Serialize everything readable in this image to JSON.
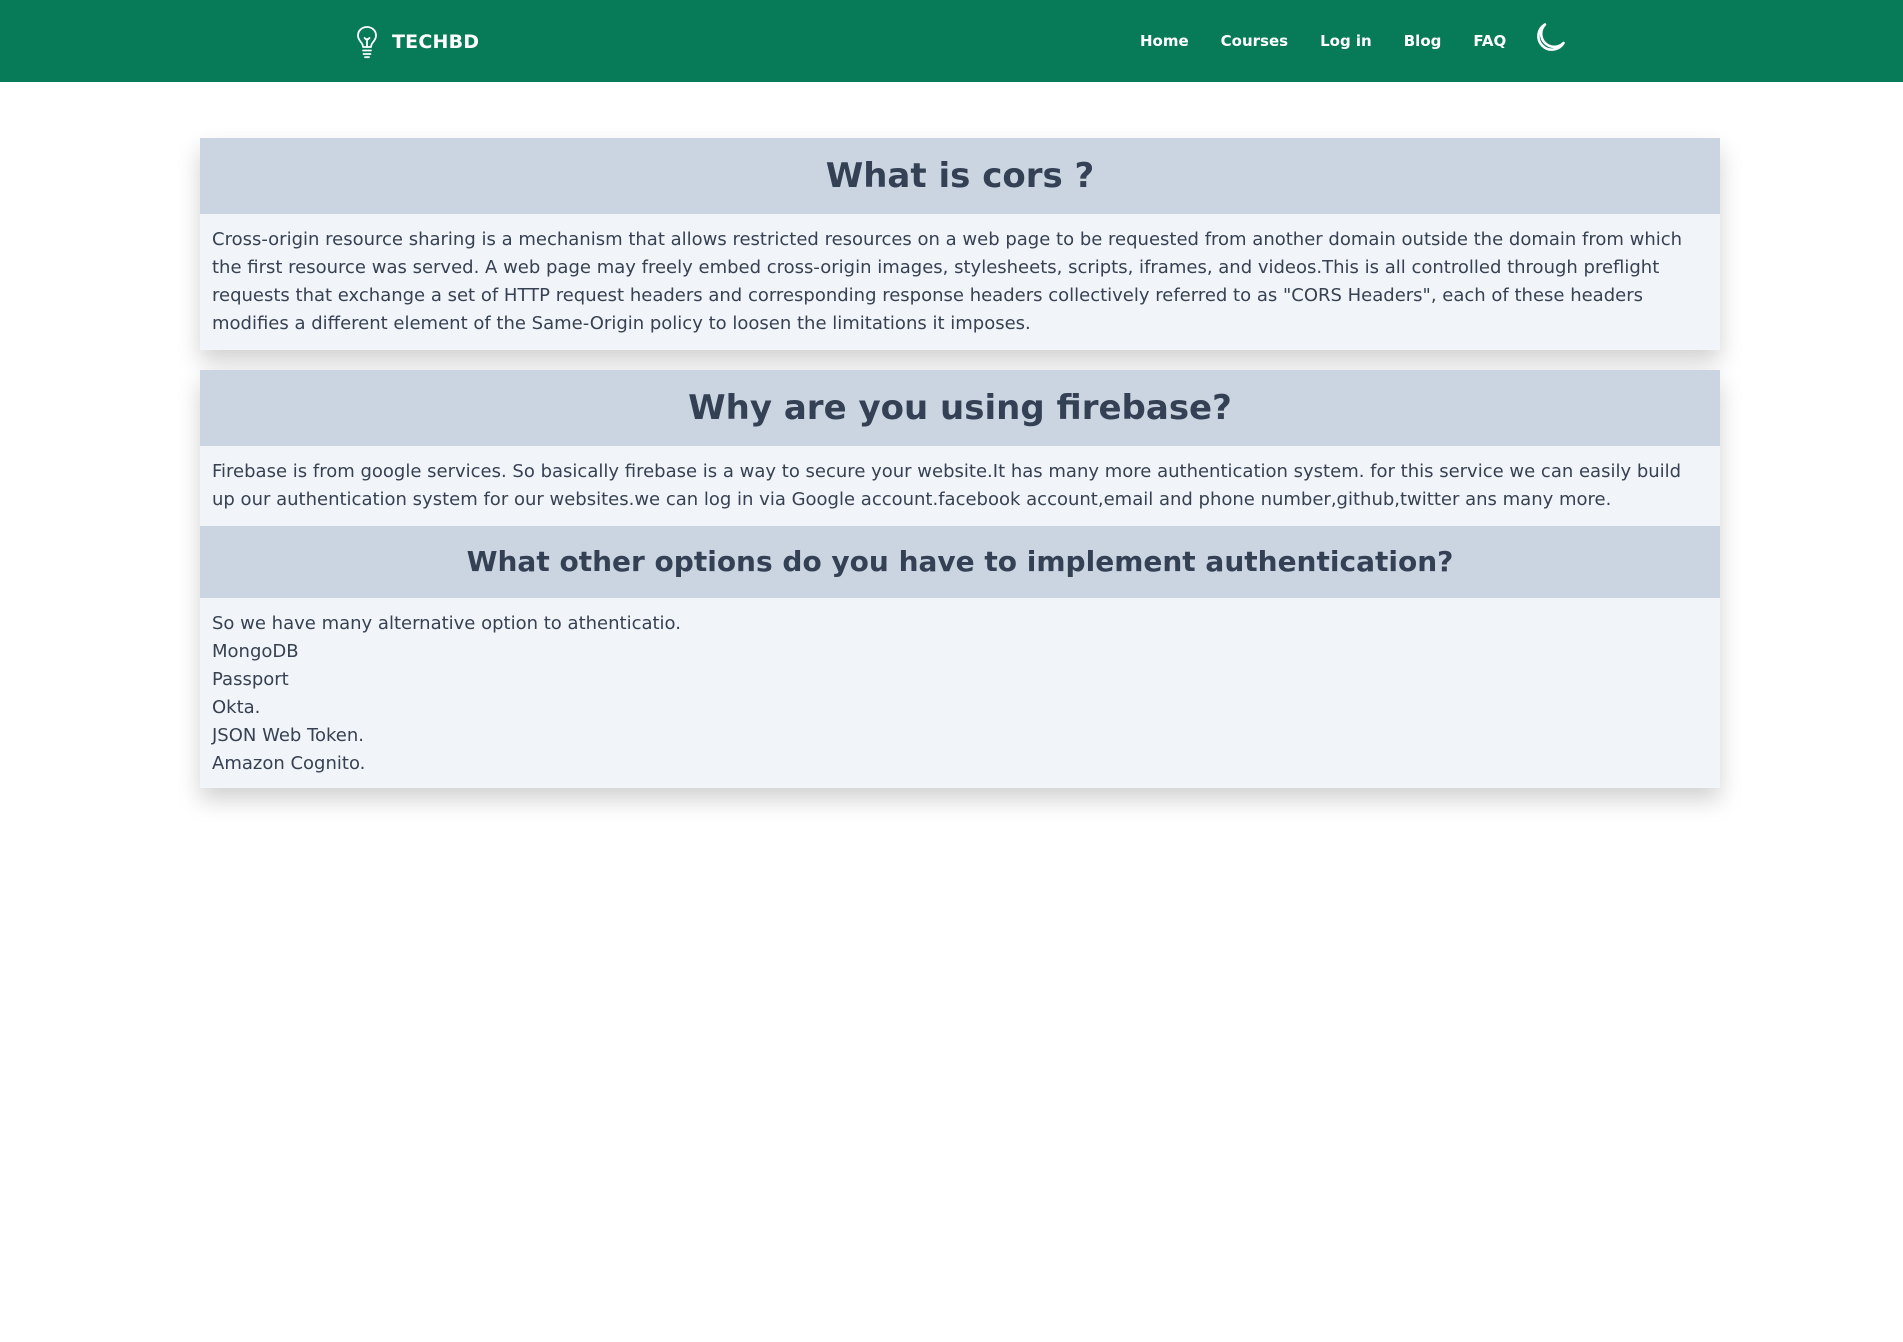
{
  "brand": {
    "name": "TECHBD",
    "icon": "lightbulb-icon"
  },
  "nav": {
    "items": [
      "Home",
      "Courses",
      "Log in",
      "Blog",
      "FAQ"
    ],
    "theme_toggle_icon": "moon-icon"
  },
  "colors": {
    "navbar": "#077a58",
    "question_header_bg": "#cbd5e1",
    "answer_bg": "#f1f5f9",
    "heading_text": "#344054",
    "body_text": "#374151"
  },
  "faq": [
    {
      "question": "What is cors ?",
      "answer": "Cross-origin resource sharing is a mechanism that allows restricted resources on a web page to be requested from another domain outside the domain from which the first resource was served. A web page may freely embed cross-origin images, stylesheets, scripts, iframes, and videos.This is all controlled through preflight requests that exchange a set of HTTP request headers and corresponding response headers collectively referred to as \"CORS Headers\", each of these headers modifies a different element of the Same-Origin policy to loosen the limitations it imposes."
    },
    {
      "question": "Why are you using firebase?",
      "answer": "Firebase is from google services. So basically firebase is a way to secure your website.It has many more authentication system. for this service we can easily build up our authentication system for our websites.we can log in via Google account.facebook account,email and phone number,github,twitter ans many more."
    },
    {
      "question": "What other options do you have to implement authentication?",
      "answer_lines": [
        "So we have many alternative option to athenticatio.",
        "MongoDB",
        "Passport",
        "Okta.",
        "JSON Web Token.",
        "Amazon Cognito."
      ]
    }
  ]
}
